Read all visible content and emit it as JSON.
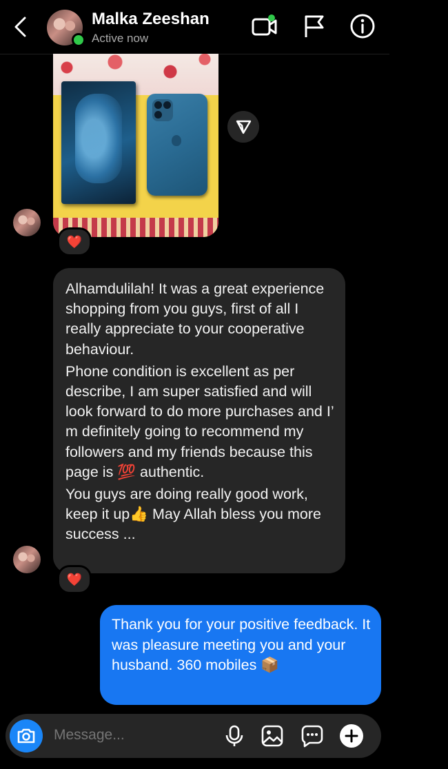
{
  "header": {
    "name": "Malka Zeeshan",
    "status": "Active now"
  },
  "icons": {
    "back": "back-chevron-icon",
    "video": "video-call-icon",
    "flag": "flag-icon",
    "info": "info-icon",
    "share": "share-icon",
    "camera": "camera-icon",
    "mic": "microphone-icon",
    "gallery": "gallery-icon",
    "sticker": "sticker-icon",
    "plus": "plus-icon"
  },
  "messages": {
    "photo_reaction": "❤️",
    "incoming_paragraphs": [
      "Alhamdulilah! It was a great experience shopping from you guys, first of all I really appreciate to your cooperative behaviour.",
      "Phone condition is excellent as per describe, I am super satisfied and will look forward to do more purchases and I’ m definitely going to recommend my followers and my friends because this page is 💯 authentic.",
      "You guys are doing really good work, keep it up👍 May Allah bless you more success ..."
    ],
    "incoming_reaction": "❤️",
    "outgoing_text": "Thank you for your positive feedback. It was pleasure meeting you and your husband. 360 mobiles 📦"
  },
  "composer": {
    "placeholder": "Message..."
  },
  "colors": {
    "background": "#000000",
    "incoming_bubble": "#262626",
    "outgoing_bubble": "#1877f2",
    "online": "#30c94a",
    "camera_button": "#1a86f8"
  }
}
